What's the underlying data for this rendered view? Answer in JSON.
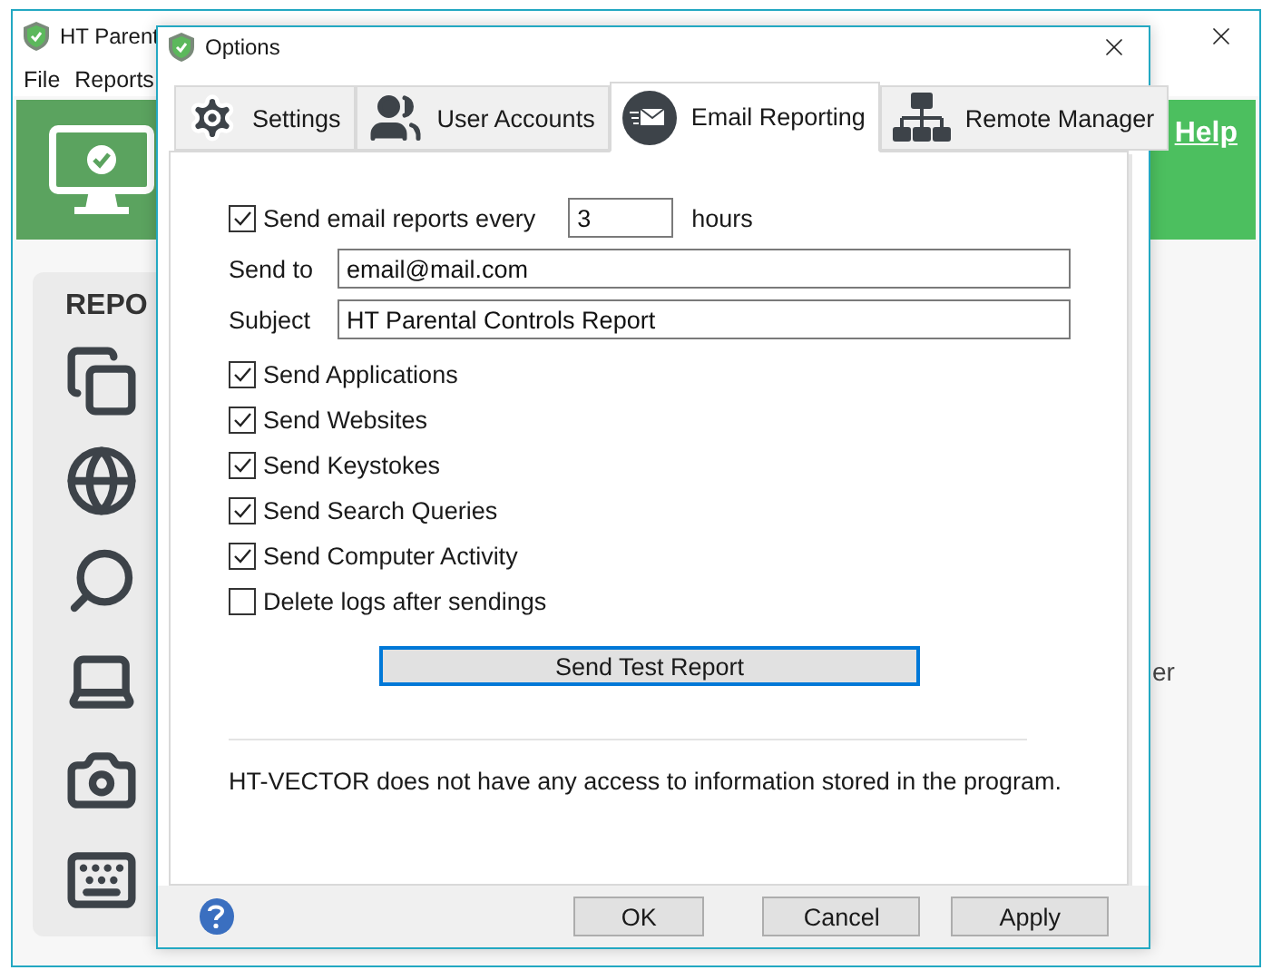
{
  "main_window": {
    "title": "HT Parent",
    "menu": [
      {
        "label": "File"
      },
      {
        "label": "Reports"
      }
    ],
    "help_link": "Help",
    "sidebar_heading": "REPO",
    "partial_text": "er"
  },
  "dialog": {
    "title": "Options",
    "tabs": [
      {
        "label": "Settings",
        "selected": false
      },
      {
        "label": "User Accounts",
        "selected": false
      },
      {
        "label": "Email Reporting",
        "selected": true
      },
      {
        "label": "Remote Manager",
        "selected": false
      }
    ],
    "interval": {
      "label": "Send email reports every",
      "checked": true,
      "value": "3",
      "unit": "hours"
    },
    "fields": [
      {
        "label": "Send to",
        "value": "email@mail.com"
      },
      {
        "label": "Subject",
        "value": "HT Parental Controls Report"
      }
    ],
    "options": [
      {
        "label": "Send Applications",
        "checked": true
      },
      {
        "label": "Send Websites",
        "checked": true
      },
      {
        "label": "Send Keystokes",
        "checked": true
      },
      {
        "label": "Send Search Queries",
        "checked": true
      },
      {
        "label": "Send Computer Activity",
        "checked": true
      },
      {
        "label": "Delete logs after sendings",
        "checked": false
      }
    ],
    "test_button": "Send Test Report",
    "note": "HT-VECTOR does not have any access to information stored in the program.",
    "buttons": [
      "OK",
      "Cancel",
      "Apply"
    ]
  }
}
